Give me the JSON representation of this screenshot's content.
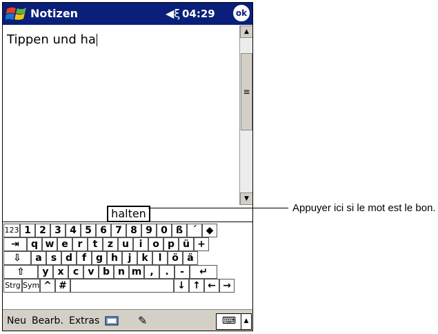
{
  "titlebar": {
    "app_name": "Notizen",
    "time": "04:29",
    "volume_icon": "speaker-icon",
    "ok_label": "ok"
  },
  "note": {
    "text": "Tippen und ha"
  },
  "suggestion": {
    "word": "halten"
  },
  "keyboard": {
    "row1": [
      "123",
      "1",
      "2",
      "3",
      "4",
      "5",
      "6",
      "7",
      "8",
      "9",
      "0",
      "ß",
      "´",
      "◆"
    ],
    "row2": [
      "⇥",
      "q",
      "w",
      "e",
      "r",
      "t",
      "z",
      "u",
      "i",
      "o",
      "p",
      "ü",
      "+"
    ],
    "row3": [
      "⇩",
      "a",
      "s",
      "d",
      "f",
      "g",
      "h",
      "j",
      "k",
      "l",
      "ö",
      "ä"
    ],
    "row4": [
      "⇧",
      "y",
      "x",
      "c",
      "v",
      "b",
      "n",
      "m",
      ",",
      ".",
      "-",
      "↵"
    ],
    "row5": [
      "Strg",
      "Sym",
      "^",
      "#",
      "",
      "↓",
      "↑",
      "←",
      "→"
    ]
  },
  "menubar": {
    "new": "Neu",
    "edit": "Bearb.",
    "tools": "Extras"
  },
  "callout": {
    "text": "Appuyer ici si le mot est le bon."
  },
  "colors": {
    "titlebar": "#0a1f7a",
    "menubar": "#d4d0c8"
  }
}
